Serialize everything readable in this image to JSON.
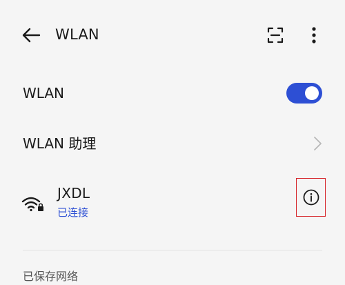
{
  "header": {
    "title": "WLAN",
    "back_icon": "arrow-left-icon",
    "scan_icon": "scan-frame-icon",
    "more_icon": "more-vertical-icon"
  },
  "wlan_row": {
    "label": "WLAN",
    "toggle_on": true
  },
  "assistant_row": {
    "label": "WLAN 助理",
    "icon": "chevron-right-icon"
  },
  "connected_network": {
    "name": "JXDL",
    "status": "已连接",
    "icon": "wifi-lock-icon",
    "info_icon": "info-circle-icon"
  },
  "saved_section": {
    "title": "已保存网络"
  },
  "colors": {
    "accent": "#2d4fd4",
    "highlight": "#d6262b",
    "background": "#f5f5f5"
  }
}
